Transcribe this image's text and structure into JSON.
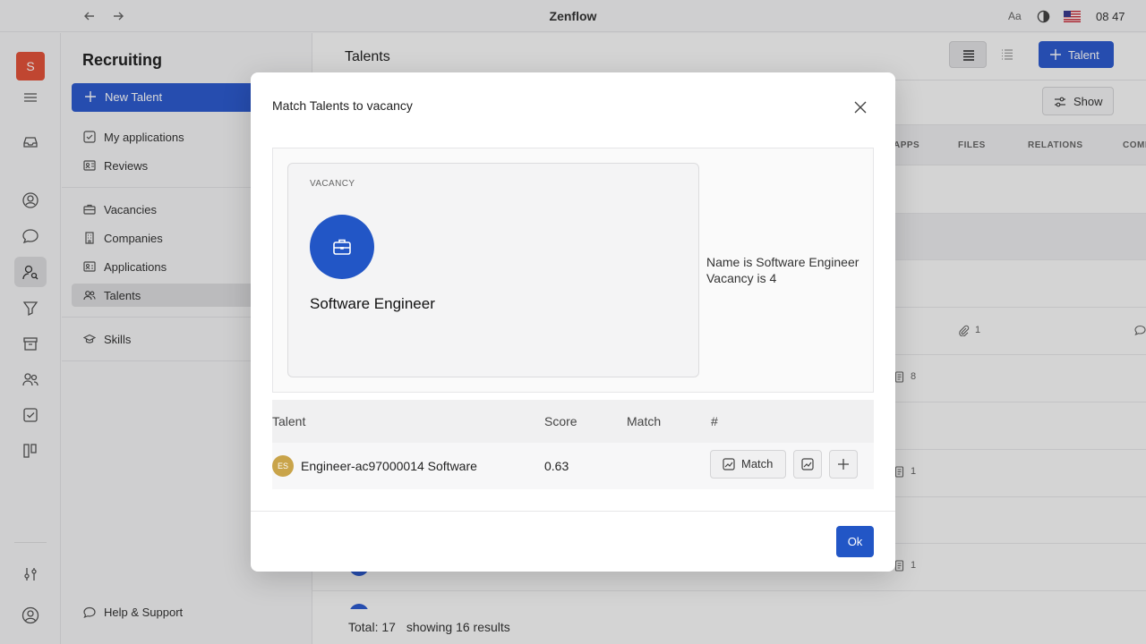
{
  "window": {
    "title": "Zenflow",
    "font_toggle": "Aa",
    "time": "08 47"
  },
  "rail": {
    "workspace_initial": "S"
  },
  "sidebar": {
    "title": "Recruiting",
    "new_talent": "New Talent",
    "items": [
      {
        "label": "My applications",
        "icon": "checkbox-icon"
      },
      {
        "label": "Reviews",
        "icon": "reviews-icon"
      },
      {
        "label": "Vacancies",
        "icon": "briefcase-icon"
      },
      {
        "label": "Companies",
        "icon": "building-icon"
      },
      {
        "label": "Applications",
        "icon": "id-card-icon"
      },
      {
        "label": "Talents",
        "icon": "people-icon",
        "active": true
      },
      {
        "label": "Skills",
        "icon": "graduation-cap-icon"
      }
    ],
    "help": "Help & Support"
  },
  "main": {
    "title": "Talents",
    "add_button": "Talent",
    "show_button": "Show",
    "columns": [
      "APPS",
      "FILES",
      "RELATIONS",
      "COMM"
    ],
    "row_counts": {
      "files_row4": "1",
      "row5": "8",
      "row7": "1",
      "row9": "1"
    },
    "footer": {
      "total": "Total: 17",
      "showing": "showing 16 results"
    }
  },
  "dialog": {
    "title": "Match Talents to vacancy",
    "vacancy_label": "VACANCY",
    "vacancy_name": "Software Engineer",
    "info_line1": "Name is Software Engineer",
    "info_line2": "Vacancy is 4",
    "table": {
      "headers": {
        "talent": "Talent",
        "score": "Score",
        "match": "Match",
        "hash": "#"
      },
      "rows": [
        {
          "initials": "ES",
          "name": "Engineer-ac97000014 Software",
          "score": "0.63",
          "match": ""
        }
      ]
    },
    "match_button": "Match",
    "ok_button": "Ok"
  },
  "colors": {
    "accent": "#2256c6",
    "workspace": "#e2533a",
    "avatar": "#c9a44a"
  }
}
